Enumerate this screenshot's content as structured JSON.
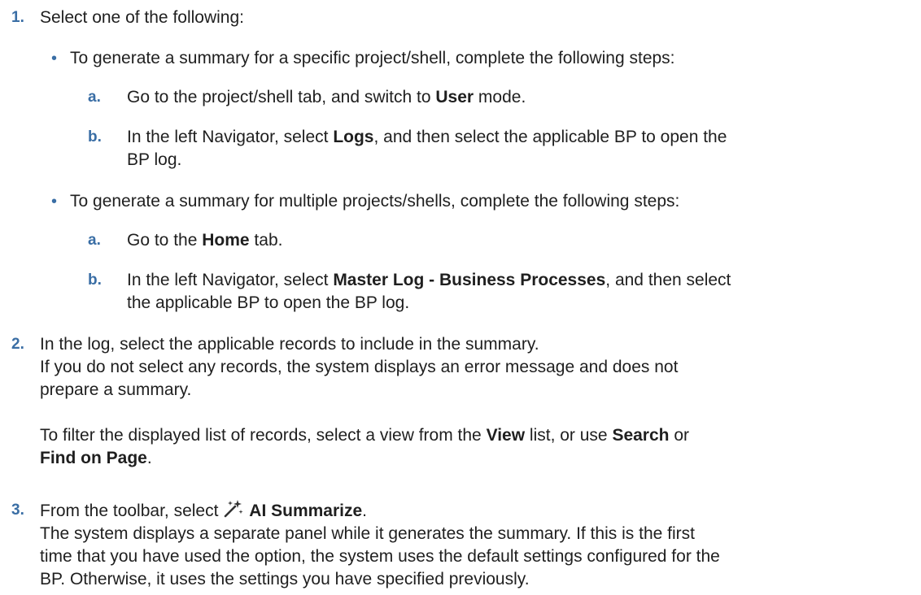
{
  "steps": [
    {
      "number": "1.",
      "intro": "Select one of the following:",
      "options": [
        {
          "text": "To generate a summary for a specific project/shell, complete the following steps:",
          "substeps": [
            {
              "letter": "a.",
              "pre": "Go to the project/shell tab, and switch to ",
              "bold": "User",
              "post": " mode."
            },
            {
              "letter": "b.",
              "pre": "In the left Navigator, select ",
              "bold": "Logs",
              "post": ", and then select the applicable BP to open the",
              "line2": "BP log."
            }
          ]
        },
        {
          "text": "To generate a summary for multiple projects/shells, complete the following steps:",
          "substeps": [
            {
              "letter": "a.",
              "pre": "Go to the ",
              "bold": "Home",
              "post": " tab."
            },
            {
              "letter": "b.",
              "pre": "In the left Navigator, select ",
              "bold": "Master Log - Business Processes",
              "post": ", and then select",
              "line2": "the applicable BP to open the BP log."
            }
          ]
        }
      ]
    },
    {
      "number": "2.",
      "line1": "In the log, select the applicable records to include in the summary.",
      "line2": "If you do not select any records, the system displays an error message and does not",
      "line3": "prepare a summary.",
      "filter": {
        "pre": "To filter the displayed list of records, select a view from the ",
        "view": "View",
        "mid1": " list, or use ",
        "search": "Search",
        "mid2": " or",
        "find": "Find on Page",
        "end": "."
      }
    },
    {
      "number": "3.",
      "pre": "From the toolbar, select ",
      "icon": "magic-wand-sparkle-icon",
      "action": "AI Summarize",
      "end": ".",
      "desc": [
        "The system displays a separate panel while it generates the summary. If this is the first",
        "time that you have used the option, the system uses the default settings configured for the",
        "BP. Otherwise, it uses the settings you have specified previously."
      ]
    }
  ],
  "colors": {
    "accent": "#3a6ea5",
    "text": "#1f1f1f"
  }
}
